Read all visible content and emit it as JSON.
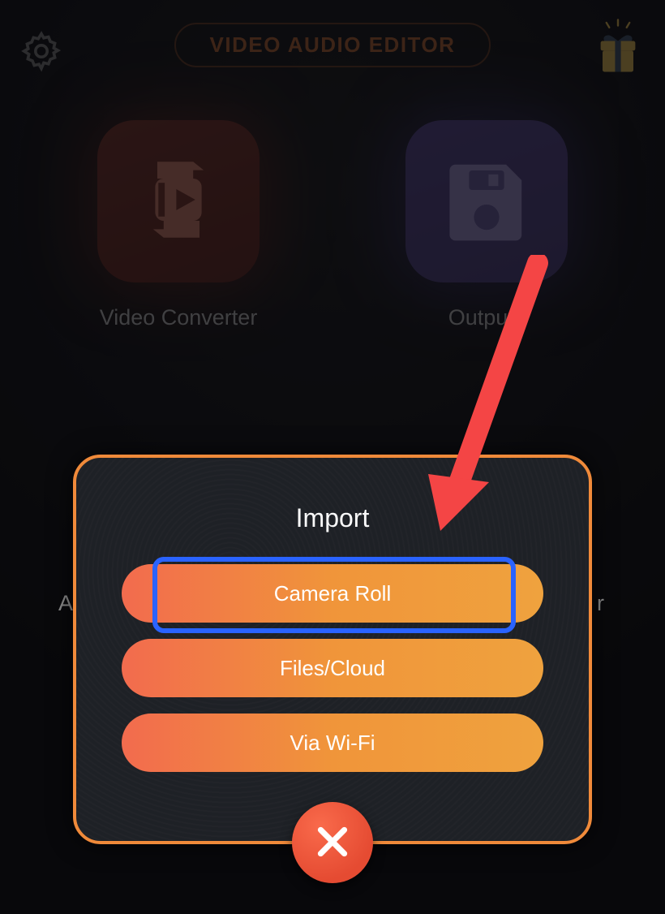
{
  "header": {
    "title": "VIDEO AUDIO EDITOR"
  },
  "cards": {
    "converter": "Video Converter",
    "outputs": "Outputs"
  },
  "bg_partial": {
    "left": "A",
    "right": "r"
  },
  "modal": {
    "title": "Import",
    "options": {
      "camera_roll": "Camera Roll",
      "files_cloud": "Files/Cloud",
      "wifi": "Via Wi-Fi"
    }
  },
  "colors": {
    "accent_orange": "#f08a3a",
    "highlight_blue": "#2a63ff",
    "arrow_red": "#f44545"
  }
}
